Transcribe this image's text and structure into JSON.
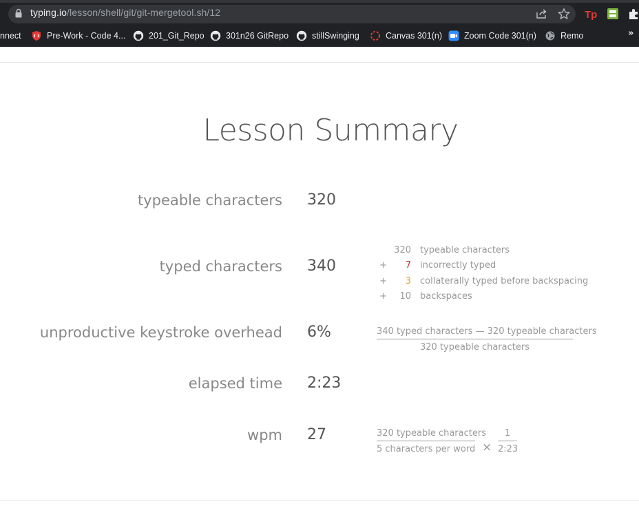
{
  "browser": {
    "url_host": "typing.io",
    "url_path": "/lesson/shell/git/git-mergetool.sh/12",
    "bookmarks": [
      {
        "label": "nnect",
        "icon": "none"
      },
      {
        "label": "Pre-Work - Code 4...",
        "icon": "codefellows-icon"
      },
      {
        "label": "201_Git_Repo",
        "icon": "github-icon"
      },
      {
        "label": "301n26 GitRepo",
        "icon": "github-icon"
      },
      {
        "label": "stillSwinging",
        "icon": "github-icon"
      },
      {
        "label": "Canvas 301(n)",
        "icon": "canvas-icon"
      },
      {
        "label": "Zoom Code 301(n)",
        "icon": "zoom-icon"
      },
      {
        "label": "Remo",
        "icon": "globe-icon"
      }
    ],
    "more_label": "»"
  },
  "summary": {
    "title": "Lesson Summary",
    "rows": [
      {
        "label": "typeable characters",
        "value": "320"
      },
      {
        "label": "typed characters",
        "value": "340"
      },
      {
        "label": "unproductive keystroke overhead",
        "value": "6%"
      },
      {
        "label": "elapsed time",
        "value": "2:23"
      },
      {
        "label": "wpm",
        "value": "27"
      }
    ],
    "breakdown": [
      {
        "op": "",
        "num": "320",
        "text": "typeable characters",
        "color": "#999999"
      },
      {
        "op": "+",
        "num": "7",
        "text": "incorrectly typed",
        "color": "#c0392b"
      },
      {
        "op": "+",
        "num": "3",
        "text": "collaterally typed before backspacing",
        "color": "#e0a030"
      },
      {
        "op": "+",
        "num": "10",
        "text": "backspaces",
        "color": "#999999"
      }
    ],
    "overhead_formula": {
      "numerator": "340 typed characters — 320 typeable characters",
      "denominator": "320 typeable characters"
    },
    "wpm_formula": {
      "numerator": "320 typeable characters",
      "denominator": "5 characters per word",
      "times": "×",
      "numerator2": "1",
      "denominator2": "2:23"
    }
  }
}
